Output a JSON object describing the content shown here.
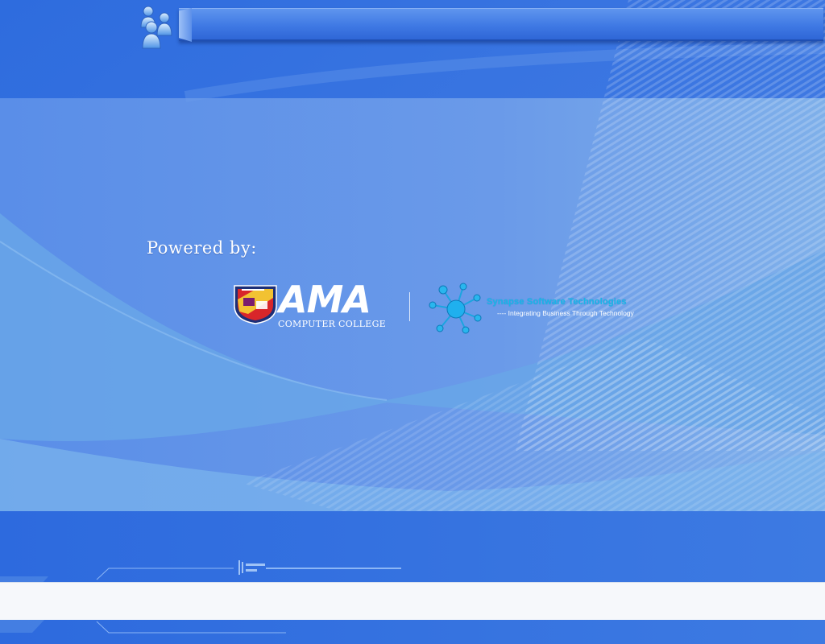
{
  "header": {
    "title": ""
  },
  "branding": {
    "powered_by_label": "Powered by:",
    "ama": {
      "name": "AMA",
      "subtitle": "COMPUTER COLLEGE"
    },
    "synapse": {
      "name": "Synapse Software Technologies",
      "tagline": "---- Integrating Business Through Technology"
    }
  },
  "status_bar": {
    "text": ""
  },
  "colors": {
    "background": "#2f6fdf",
    "accent": "#18b6e9",
    "status_bar": "#f6f8fb"
  },
  "icons": [
    "users-group-icon",
    "ama-crest-icon",
    "synapse-network-icon"
  ]
}
